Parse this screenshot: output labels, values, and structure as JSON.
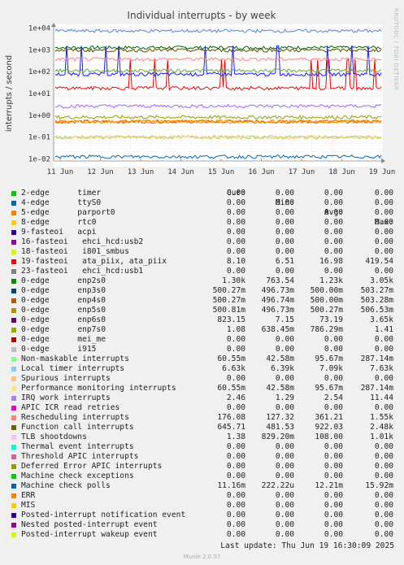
{
  "chart_data": {
    "type": "line",
    "title": "Individual interrupts - by week",
    "ylabel": "interrupts / second",
    "y_scale": "log",
    "y_ticks": [
      "1e+04",
      "1e+03",
      "1e+02",
      "1e+01",
      "1e+00",
      "1e-01",
      "1e-02"
    ],
    "x_ticks": [
      "11 Jun",
      "12 Jun",
      "13 Jun",
      "14 Jun",
      "15 Jun",
      "16 Jun",
      "17 Jun",
      "18 Jun",
      "19 Jun"
    ],
    "series": [
      {
        "name": "enp2s0",
        "color": "#006600",
        "level": 1230
      },
      {
        "name": "enp3s0",
        "color": "#FF8000",
        "level": 0.5
      },
      {
        "name": "enp4s0",
        "color": "#CC6600",
        "level": 0.5
      },
      {
        "name": "enp5s0",
        "color": "#FF9900",
        "level": 0.5
      },
      {
        "name": "enp6s0",
        "color": "#1A1AFF",
        "level": 73
      },
      {
        "name": "enp7s0",
        "color": "#8FA600",
        "level": 0.79
      },
      {
        "name": "19-fasteoi ata_piix, ata_piix",
        "color": "#EE0000",
        "level": 17
      },
      {
        "name": "Non-maskable interrupts",
        "color": "#99CC66",
        "level": 0.096
      },
      {
        "name": "Local timer interrupts",
        "color": "#5588CC",
        "level": 7090
      },
      {
        "name": "Performance monitoring interrupts",
        "color": "#FFCC66",
        "level": 0.096
      },
      {
        "name": "IRQ work interrupts",
        "color": "#9966FF",
        "level": 2.54
      },
      {
        "name": "Rescheduling interrupts",
        "color": "#FF8080",
        "level": 361
      },
      {
        "name": "Function call interrupts",
        "color": "#555500",
        "level": 922
      },
      {
        "name": "TLB shootdowns",
        "color": "#66AA33",
        "level": 108
      },
      {
        "name": "Machine check polls",
        "color": "#0066B3",
        "level": 0.0122
      }
    ]
  },
  "legend": {
    "headers": [
      "Cur:",
      "Min:",
      "Avg:",
      "Max:"
    ],
    "rows": [
      {
        "name": "2-edge      timer",
        "color": "#00CC00",
        "cur": "0.00",
        "min": "0.00",
        "avg": "0.00",
        "max": "0.00"
      },
      {
        "name": "4-edge      ttyS0",
        "color": "#0066B3",
        "cur": "0.00",
        "min": "0.00",
        "avg": "0.00",
        "max": "0.00"
      },
      {
        "name": "5-edge      parport0",
        "color": "#FF8000",
        "cur": "0.00",
        "min": "0.00",
        "avg": "0.00",
        "max": "0.00"
      },
      {
        "name": "8-edge      rtc0",
        "color": "#FFCC00",
        "cur": "0.00",
        "min": "0.00",
        "avg": "0.00",
        "max": "0.00"
      },
      {
        "name": "9-fasteoi   acpi",
        "color": "#330099",
        "cur": "0.00",
        "min": "0.00",
        "avg": "0.00",
        "max": "0.00"
      },
      {
        "name": "16-fasteoi   ehci_hcd:usb2",
        "color": "#990099",
        "cur": "0.00",
        "min": "0.00",
        "avg": "0.00",
        "max": "0.00"
      },
      {
        "name": "18-fasteoi   i801_smbus",
        "color": "#CCFF00",
        "cur": "0.00",
        "min": "0.00",
        "avg": "0.00",
        "max": "0.00"
      },
      {
        "name": "19-fasteoi   ata_piix, ata_piix",
        "color": "#FF0000",
        "cur": "8.10",
        "min": "6.51",
        "avg": "16.98",
        "max": "419.54"
      },
      {
        "name": "23-fasteoi   ehci_hcd:usb1",
        "color": "#808080",
        "cur": "0.00",
        "min": "0.00",
        "avg": "0.00",
        "max": "0.00"
      },
      {
        "name": "0-edge      enp2s0",
        "color": "#008F00",
        "cur": "1.30k",
        "min": "763.54",
        "avg": "1.23k",
        "max": "3.05k"
      },
      {
        "name": "0-edge      enp3s0",
        "color": "#00487D",
        "cur": "500.27m",
        "min": "496.73m",
        "avg": "500.00m",
        "max": "503.27m"
      },
      {
        "name": "0-edge      enp4s0",
        "color": "#B35A00",
        "cur": "500.27m",
        "min": "496.74m",
        "avg": "500.00m",
        "max": "503.28m"
      },
      {
        "name": "0-edge      enp5s0",
        "color": "#B38F00",
        "cur": "500.81m",
        "min": "496.73m",
        "avg": "500.27m",
        "max": "506.53m"
      },
      {
        "name": "0-edge      enp6s0",
        "color": "#6B006B",
        "cur": "823.15",
        "min": "7.15",
        "avg": "73.19",
        "max": "3.65k"
      },
      {
        "name": "0-edge      enp7s0",
        "color": "#8FB300",
        "cur": "1.08",
        "min": "638.45m",
        "avg": "786.29m",
        "max": "1.41"
      },
      {
        "name": "0-edge      mei_me",
        "color": "#B30000",
        "cur": "0.00",
        "min": "0.00",
        "avg": "0.00",
        "max": "0.00"
      },
      {
        "name": "0-edge      i915",
        "color": "#BEBEBE",
        "cur": "0.00",
        "min": "0.00",
        "avg": "0.00",
        "max": "0.00"
      },
      {
        "name": "Non-maskable interrupts",
        "color": "#80FF80",
        "cur": "60.55m",
        "min": "42.58m",
        "avg": "95.67m",
        "max": "287.14m"
      },
      {
        "name": "Local timer interrupts",
        "color": "#80C9FF",
        "cur": "6.63k",
        "min": "6.39k",
        "avg": "7.09k",
        "max": "7.63k"
      },
      {
        "name": "Spurious interrupts",
        "color": "#FFC080",
        "cur": "0.00",
        "min": "0.00",
        "avg": "0.00",
        "max": "0.00"
      },
      {
        "name": "Performance monitoring interrupts",
        "color": "#FFE680",
        "cur": "60.55m",
        "min": "42.58m",
        "avg": "95.67m",
        "max": "287.14m"
      },
      {
        "name": "IRQ work interrupts",
        "color": "#AA80FF",
        "cur": "2.46",
        "min": "1.29",
        "avg": "2.54",
        "max": "11.44"
      },
      {
        "name": "APIC ICR read retries",
        "color": "#EE00CC",
        "cur": "0.00",
        "min": "0.00",
        "avg": "0.00",
        "max": "0.00"
      },
      {
        "name": "Rescheduling interrupts",
        "color": "#FF8080",
        "cur": "176.08",
        "min": "127.32",
        "avg": "361.21",
        "max": "1.55k"
      },
      {
        "name": "Function call interrupts",
        "color": "#666600",
        "cur": "645.71",
        "min": "481.53",
        "avg": "922.03",
        "max": "2.48k"
      },
      {
        "name": "TLB shootdowns",
        "color": "#FFBFFF",
        "cur": "1.38",
        "min": "829.20m",
        "avg": "108.00",
        "max": "1.01k"
      },
      {
        "name": "Thermal event interrupts",
        "color": "#00FFCC",
        "cur": "0.00",
        "min": "0.00",
        "avg": "0.00",
        "max": "0.00"
      },
      {
        "name": "Threshold APIC interrupts",
        "color": "#CC6699",
        "cur": "0.00",
        "min": "0.00",
        "avg": "0.00",
        "max": "0.00"
      },
      {
        "name": "Deferred Error APIC interrupts",
        "color": "#999900",
        "cur": "0.00",
        "min": "0.00",
        "avg": "0.00",
        "max": "0.00"
      },
      {
        "name": "Machine check exceptions",
        "color": "#00CC00",
        "cur": "0.00",
        "min": "0.00",
        "avg": "0.00",
        "max": "0.00"
      },
      {
        "name": "Machine check polls",
        "color": "#0066B3",
        "cur": "11.16m",
        "min": "222.22u",
        "avg": "12.21m",
        "max": "15.92m"
      },
      {
        "name": "ERR",
        "color": "#FF8000",
        "cur": "0.00",
        "min": "0.00",
        "avg": "0.00",
        "max": "0.00"
      },
      {
        "name": "MIS",
        "color": "#FFCC00",
        "cur": "0.00",
        "min": "0.00",
        "avg": "0.00",
        "max": "0.00"
      },
      {
        "name": "Posted-interrupt notification event",
        "color": "#330099",
        "cur": "0.00",
        "min": "0.00",
        "avg": "0.00",
        "max": "0.00"
      },
      {
        "name": "Nested posted-interrupt event",
        "color": "#990099",
        "cur": "0.00",
        "min": "0.00",
        "avg": "0.00",
        "max": "0.00"
      },
      {
        "name": "Posted-interrupt wakeup event",
        "color": "#CCFF00",
        "cur": "0.00",
        "min": "0.00",
        "avg": "0.00",
        "max": "0.00"
      }
    ]
  },
  "footer": {
    "last_update": "Last update: Thu Jun 19 16:30:09 2025",
    "munin": "Munin 2.0.57",
    "side_label": "RRDTOOL / TOBI OETIKER"
  }
}
